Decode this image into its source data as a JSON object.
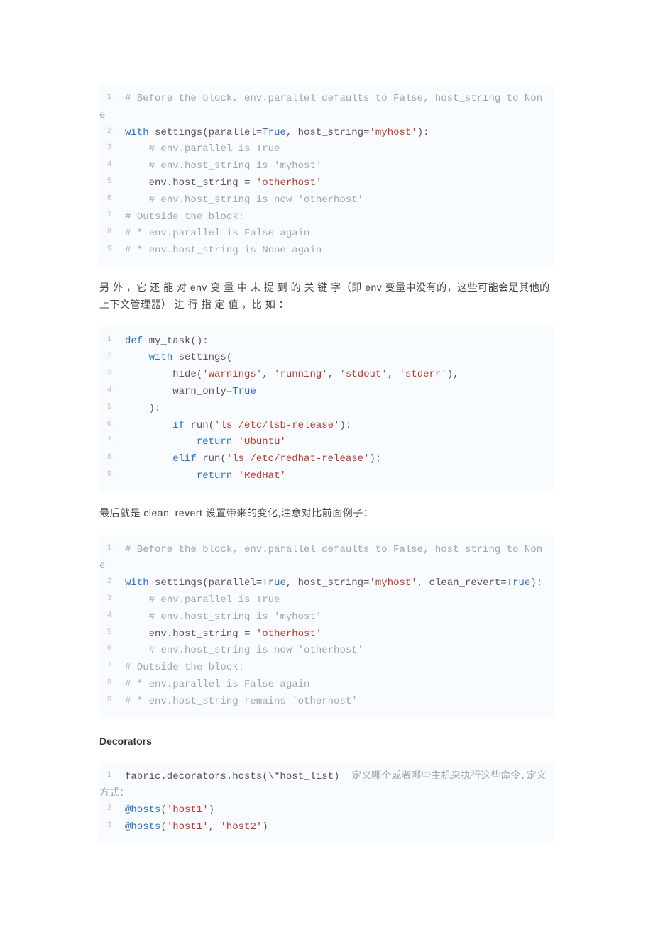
{
  "block1": {
    "lines": [
      [
        {
          "cls": "com",
          "t": "# Before the block, env.parallel defaults to False, host_string to None"
        }
      ],
      [
        {
          "cls": "kw",
          "t": "with"
        },
        {
          "cls": "pun",
          "t": " settings(parallel="
        },
        {
          "cls": "lit",
          "t": "True"
        },
        {
          "cls": "pun",
          "t": ", host_string="
        },
        {
          "cls": "str",
          "t": "'myhost'"
        },
        {
          "cls": "pun",
          "t": "):"
        }
      ],
      [
        {
          "cls": "pun",
          "t": "    "
        },
        {
          "cls": "com",
          "t": "# env.parallel is True"
        }
      ],
      [
        {
          "cls": "pun",
          "t": "    "
        },
        {
          "cls": "com",
          "t": "# env.host_string is 'myhost'"
        }
      ],
      [
        {
          "cls": "pun",
          "t": "    env.host_string = "
        },
        {
          "cls": "str",
          "t": "'otherhost'"
        }
      ],
      [
        {
          "cls": "pun",
          "t": "    "
        },
        {
          "cls": "com",
          "t": "# env.host_string is now 'otherhost'"
        }
      ],
      [
        {
          "cls": "com",
          "t": "# Outside the block:"
        }
      ],
      [
        {
          "cls": "com",
          "t": "# * env.parallel is False again"
        }
      ],
      [
        {
          "cls": "com",
          "t": "# * env.host_string is None again"
        }
      ]
    ]
  },
  "para1": "另 外 ，它 还 能 对 env 变 量 中 未 提 到 的 关 键 字（即 env 变量中没有的，这些可能会是其他的上下文管理器） 进 行 指 定 值 ，比 如 ：",
  "block2": {
    "lines": [
      [
        {
          "cls": "kw",
          "t": "def"
        },
        {
          "cls": "pun",
          "t": " my_task():"
        }
      ],
      [
        {
          "cls": "pun",
          "t": "    "
        },
        {
          "cls": "kw",
          "t": "with"
        },
        {
          "cls": "pun",
          "t": " settings("
        }
      ],
      [
        {
          "cls": "pun",
          "t": "        hide("
        },
        {
          "cls": "str",
          "t": "'warnings'"
        },
        {
          "cls": "pun",
          "t": ", "
        },
        {
          "cls": "str",
          "t": "'running'"
        },
        {
          "cls": "pun",
          "t": ", "
        },
        {
          "cls": "str",
          "t": "'stdout'"
        },
        {
          "cls": "pun",
          "t": ", "
        },
        {
          "cls": "str",
          "t": "'stderr'"
        },
        {
          "cls": "pun",
          "t": "),"
        }
      ],
      [
        {
          "cls": "pun",
          "t": "        warn_only="
        },
        {
          "cls": "lit",
          "t": "True"
        }
      ],
      [
        {
          "cls": "pun",
          "t": "    ):"
        }
      ],
      [
        {
          "cls": "pun",
          "t": "        "
        },
        {
          "cls": "kw",
          "t": "if"
        },
        {
          "cls": "pun",
          "t": " run("
        },
        {
          "cls": "str",
          "t": "'ls /etc/lsb-release'"
        },
        {
          "cls": "pun",
          "t": "):"
        }
      ],
      [
        {
          "cls": "pun",
          "t": "            "
        },
        {
          "cls": "kw",
          "t": "return"
        },
        {
          "cls": "pun",
          "t": " "
        },
        {
          "cls": "str",
          "t": "'Ubuntu'"
        }
      ],
      [
        {
          "cls": "pun",
          "t": "        "
        },
        {
          "cls": "kw",
          "t": "elif"
        },
        {
          "cls": "pun",
          "t": " run("
        },
        {
          "cls": "str",
          "t": "'ls /etc/redhat-release'"
        },
        {
          "cls": "pun",
          "t": "):"
        }
      ],
      [
        {
          "cls": "pun",
          "t": "            "
        },
        {
          "cls": "kw",
          "t": "return"
        },
        {
          "cls": "pun",
          "t": " "
        },
        {
          "cls": "str",
          "t": "'RedHat'"
        }
      ]
    ]
  },
  "para2": "最后就是 clean_revert 设置带来的变化,注意对比前面例子：",
  "block3": {
    "lines": [
      [
        {
          "cls": "com",
          "t": "# Before the block, env.parallel defaults to False, host_string to None"
        }
      ],
      [
        {
          "cls": "kw",
          "t": "with"
        },
        {
          "cls": "pun",
          "t": " settings(parallel="
        },
        {
          "cls": "lit",
          "t": "True"
        },
        {
          "cls": "pun",
          "t": ", host_string="
        },
        {
          "cls": "str",
          "t": "'myhost'"
        },
        {
          "cls": "pun",
          "t": ", clean_revert="
        },
        {
          "cls": "lit",
          "t": "True"
        },
        {
          "cls": "pun",
          "t": "):"
        }
      ],
      [
        {
          "cls": "pun",
          "t": "    "
        },
        {
          "cls": "com",
          "t": "# env.parallel is True"
        }
      ],
      [
        {
          "cls": "pun",
          "t": "    "
        },
        {
          "cls": "com",
          "t": "# env.host_string is 'myhost'"
        }
      ],
      [
        {
          "cls": "pun",
          "t": "    env.host_string = "
        },
        {
          "cls": "str",
          "t": "'otherhost'"
        }
      ],
      [
        {
          "cls": "pun",
          "t": "    "
        },
        {
          "cls": "com",
          "t": "# env.host_string is now 'otherhost'"
        }
      ],
      [
        {
          "cls": "com",
          "t": "# Outside the block:"
        }
      ],
      [
        {
          "cls": "com",
          "t": "# * env.parallel is False again"
        }
      ],
      [
        {
          "cls": "com",
          "t": "# * env.host_string remains 'otherhost'"
        }
      ]
    ]
  },
  "heading": "Decorators",
  "block4": {
    "lines": [
      [
        {
          "cls": "pun",
          "t": "fabric.decorators.hosts(\\*host_list)  "
        },
        {
          "cls": "com",
          "t": "定义哪个或者哪些主机来执行这些命令,定义方式："
        }
      ],
      [
        {
          "cls": "kw",
          "t": "@hosts"
        },
        {
          "cls": "pun",
          "t": "("
        },
        {
          "cls": "str",
          "t": "'host1'"
        },
        {
          "cls": "pun",
          "t": ")"
        }
      ],
      [
        {
          "cls": "kw",
          "t": "@hosts"
        },
        {
          "cls": "pun",
          "t": "("
        },
        {
          "cls": "str",
          "t": "'host1'"
        },
        {
          "cls": "pun",
          "t": ", "
        },
        {
          "cls": "str",
          "t": "'host2'"
        },
        {
          "cls": "pun",
          "t": ")"
        }
      ]
    ]
  }
}
